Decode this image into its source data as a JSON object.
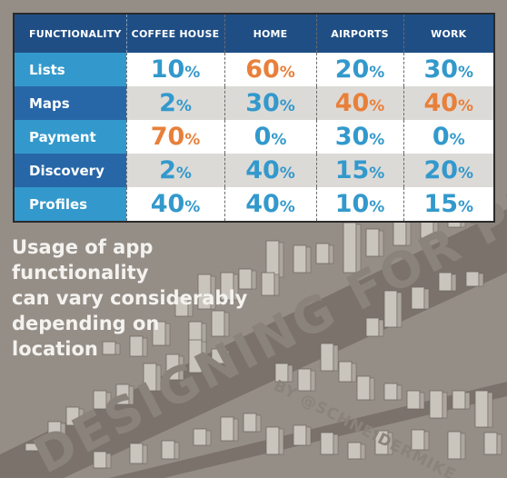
{
  "table": {
    "headers": [
      "FUNCTIONALITY",
      "COFFEE HOUSE",
      "HOME",
      "AIRPORTS",
      "WORK"
    ],
    "rows": [
      {
        "label": "Lists",
        "values": [
          {
            "n": "10",
            "c": "blue"
          },
          {
            "n": "60",
            "c": "orange"
          },
          {
            "n": "20",
            "c": "blue"
          },
          {
            "n": "30",
            "c": "blue"
          }
        ]
      },
      {
        "label": "Maps",
        "values": [
          {
            "n": "2",
            "c": "blue"
          },
          {
            "n": "30",
            "c": "blue"
          },
          {
            "n": "40",
            "c": "orange"
          },
          {
            "n": "40",
            "c": "orange"
          }
        ]
      },
      {
        "label": "Payment",
        "values": [
          {
            "n": "70",
            "c": "orange"
          },
          {
            "n": "0",
            "c": "blue"
          },
          {
            "n": "30",
            "c": "blue"
          },
          {
            "n": "0",
            "c": "blue"
          }
        ]
      },
      {
        "label": "Discovery",
        "values": [
          {
            "n": "2",
            "c": "blue"
          },
          {
            "n": "40",
            "c": "blue"
          },
          {
            "n": "15",
            "c": "blue"
          },
          {
            "n": "20",
            "c": "blue"
          }
        ]
      },
      {
        "label": "Profiles",
        "values": [
          {
            "n": "40",
            "c": "blue"
          },
          {
            "n": "40",
            "c": "blue"
          },
          {
            "n": "10",
            "c": "blue"
          },
          {
            "n": "15",
            "c": "blue"
          }
        ]
      }
    ],
    "percent_sign": "%"
  },
  "caption": {
    "lines": [
      "Usage of app functionality",
      "can vary considerably",
      "depending on",
      "location"
    ]
  },
  "illustration": {
    "street_title": "DESIGNING FOR PLACE",
    "byline": "BY @SCHNEIDERMIKE",
    "description": "isometric-city-buildings"
  },
  "colors": {
    "background": "#958e87",
    "header_blue": "#1f4e85",
    "label_light_blue": "#3399cc",
    "label_mid_blue": "#2767a8",
    "value_blue": "#3399cc",
    "value_orange": "#e8803a",
    "alt_row_gray": "#dcdad7",
    "street": "#7a726b"
  }
}
